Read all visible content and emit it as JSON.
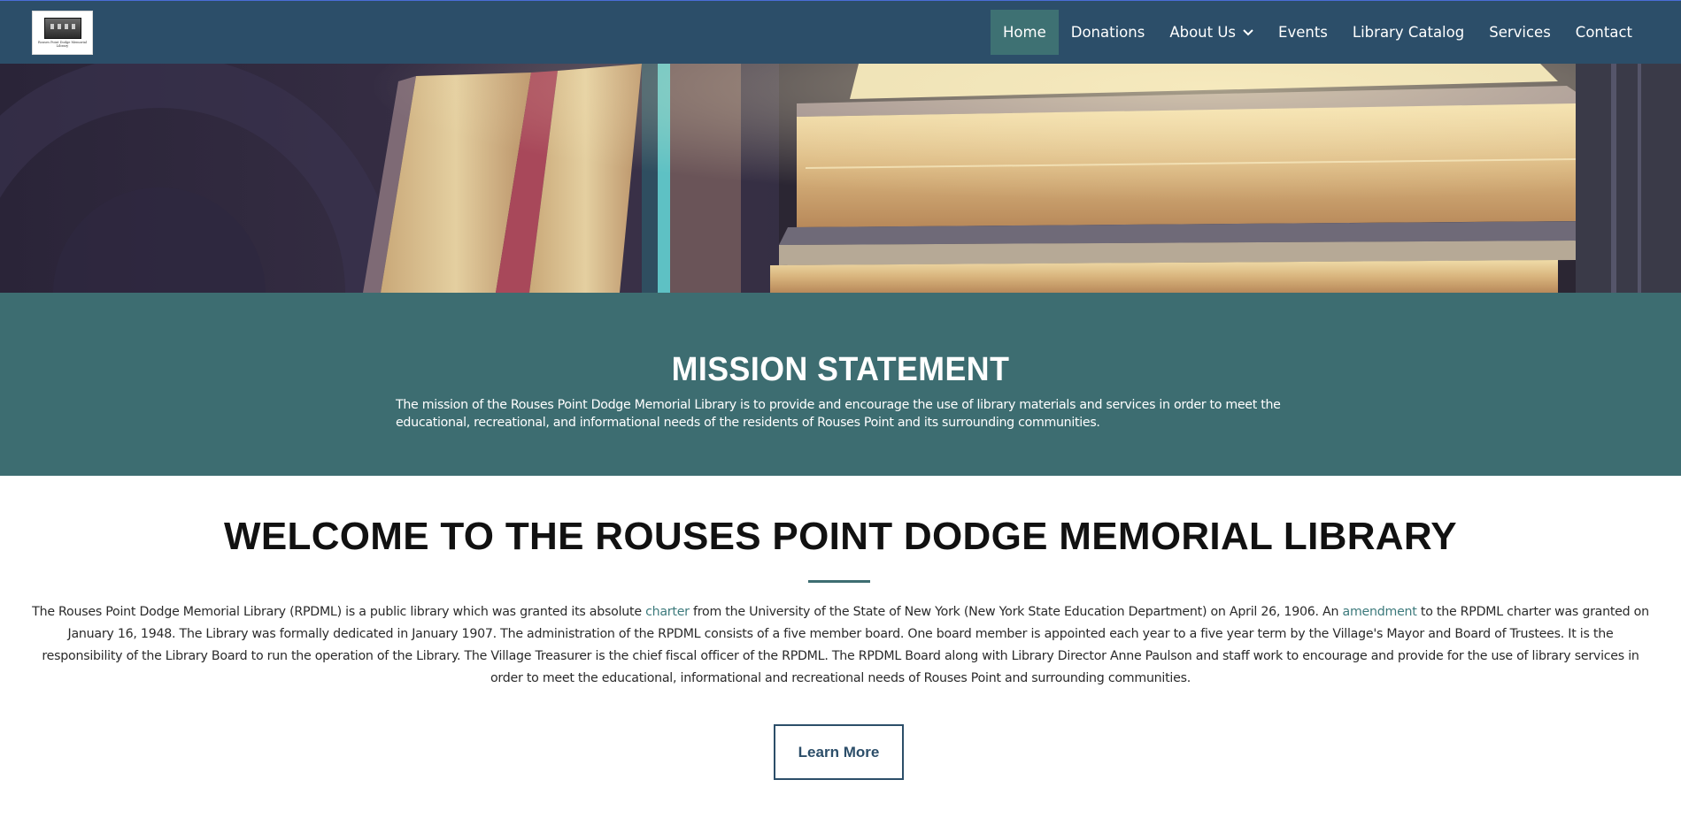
{
  "logo": {
    "caption": "Rouses Point Dodge Memorial Library"
  },
  "nav": {
    "items": [
      {
        "label": "Home",
        "active": true
      },
      {
        "label": "Donations"
      },
      {
        "label": "About Us",
        "has_dropdown": true
      },
      {
        "label": "Events"
      },
      {
        "label": "Library Catalog"
      },
      {
        "label": "Services"
      },
      {
        "label": "Contact"
      }
    ]
  },
  "mission": {
    "title": "MISSION STATEMENT",
    "text": "The mission of the Rouses Point Dodge Memorial Library is to provide and encourage the use of library materials and services in order to meet the educational, recreational, and informational needs of the residents of Rouses Point and its surrounding communities."
  },
  "welcome": {
    "title": "WELCOME TO THE ROUSES POINT DODGE MEMORIAL LIBRARY",
    "text_1": "The Rouses Point Dodge Memorial Library (RPDML) is a public library which was granted its absolute ",
    "link_charter": "charter",
    "text_2": " from the University of the State of New York (New York State Education Department) on April 26, 1906.  An ",
    "link_amendment": "amendment",
    "text_3": " to the RPDML charter was granted on January 16, 1948.  The Library was formally dedicated in January 1907. The administration of the RPDML consists of a five member board.  One board member is appointed each year to a five year term by the Village's Mayor and Board of Trustees.  It is the responsibility of the Library Board to run the operation of the Library.  The Village Treasurer is the chief fiscal officer of the RPDML.  The RPDML Board along with Library Director Anne Paulson and staff work to encourage and provide for the use of library services in order to meet the educational, informational and recreational needs of Rouses Point and surrounding communities.",
    "button_label": "Learn More"
  },
  "colors": {
    "navbar": "#2c4e69",
    "accent": "#3d6d71",
    "link": "#3d7a7c"
  }
}
